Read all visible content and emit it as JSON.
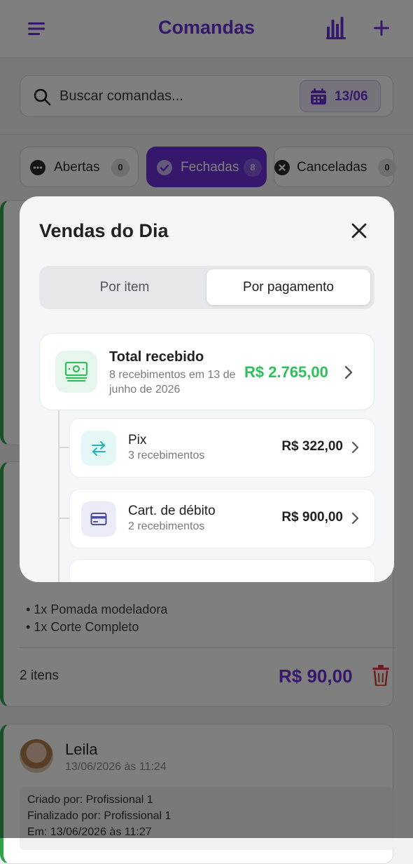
{
  "header": {
    "title": "Comandas"
  },
  "search": {
    "placeholder": "Buscar comandas...",
    "date": "13/06"
  },
  "filters": [
    {
      "label": "Abertas",
      "count": "0",
      "active": false
    },
    {
      "label": "Fechadas",
      "count": "8",
      "active": true
    },
    {
      "label": "Canceladas",
      "count": "0",
      "active": false
    }
  ],
  "order_card": {
    "items": [
      "• 1x Pomada modeladora",
      "• 1x Corte Completo"
    ],
    "count_label": "2 itens",
    "total": "R$ 90,00"
  },
  "next_card": {
    "client_name": "Leila",
    "client_date": "13/06/2026 às 11:24",
    "info": [
      "Criado por: Profissional 1",
      "Finalizado por: Profissional 1",
      "Em: 13/06/2026 às 11:27"
    ]
  },
  "modal": {
    "title": "Vendas do Dia",
    "tabs": [
      {
        "label": "Por item",
        "selected": false
      },
      {
        "label": "Por pagamento",
        "selected": true
      }
    ],
    "total": {
      "title": "Total recebido",
      "subtitle": "8 recebimentos em 13 de junho de 2026",
      "amount": "R$ 2.765,00"
    },
    "payments": [
      {
        "name": "Pix",
        "subtitle": "3 recebimentos",
        "amount": "R$ 322,00",
        "icon": "pix-transfer-icon",
        "icon_color": "#24b5b5",
        "icon_bg": "#e3f7f7"
      },
      {
        "name": "Cart. de débito",
        "subtitle": "2 recebimentos",
        "amount": "R$ 900,00",
        "icon": "credit-card-icon",
        "icon_color": "#4b4e9c",
        "icon_bg": "#ececf8"
      }
    ]
  },
  "colors": {
    "accent": "#6a2fd6",
    "success": "#2fbf5b",
    "danger": "#d93b3b",
    "card_stripe": "#2fa24a"
  }
}
